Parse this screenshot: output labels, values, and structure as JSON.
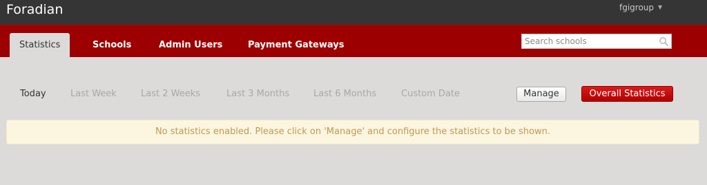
{
  "app": {
    "brand": "Foradian"
  },
  "user_menu": {
    "username": "fgigroup"
  },
  "nav": {
    "tabs": [
      {
        "label": "Statistics",
        "active": true
      },
      {
        "label": "Schools"
      },
      {
        "label": "Admin Users"
      },
      {
        "label": "Payment Gateways"
      }
    ]
  },
  "search": {
    "placeholder": "Search schools",
    "value": ""
  },
  "periods": [
    {
      "label": "Today",
      "active": true
    },
    {
      "label": "Last Week"
    },
    {
      "label": "Last 2 Weeks"
    },
    {
      "label": "Last 3 Months"
    },
    {
      "label": "Last 6 Months"
    },
    {
      "label": "Custom Date"
    }
  ],
  "actions": {
    "manage_label": "Manage",
    "overall_label": "Overall Statistics"
  },
  "notice": {
    "message": "No statistics enabled. Please click on 'Manage' and configure the statistics to be shown."
  },
  "colors": {
    "topbar": "#353535",
    "navbar": "#9c0000",
    "accent_button": "#c00000",
    "notice_bg": "#fcf6e0",
    "notice_text": "#c09853",
    "page_bg": "#dcdbda"
  },
  "icons": {
    "search": "magnifier-icon",
    "user_menu_caret": "caret-down-icon"
  }
}
